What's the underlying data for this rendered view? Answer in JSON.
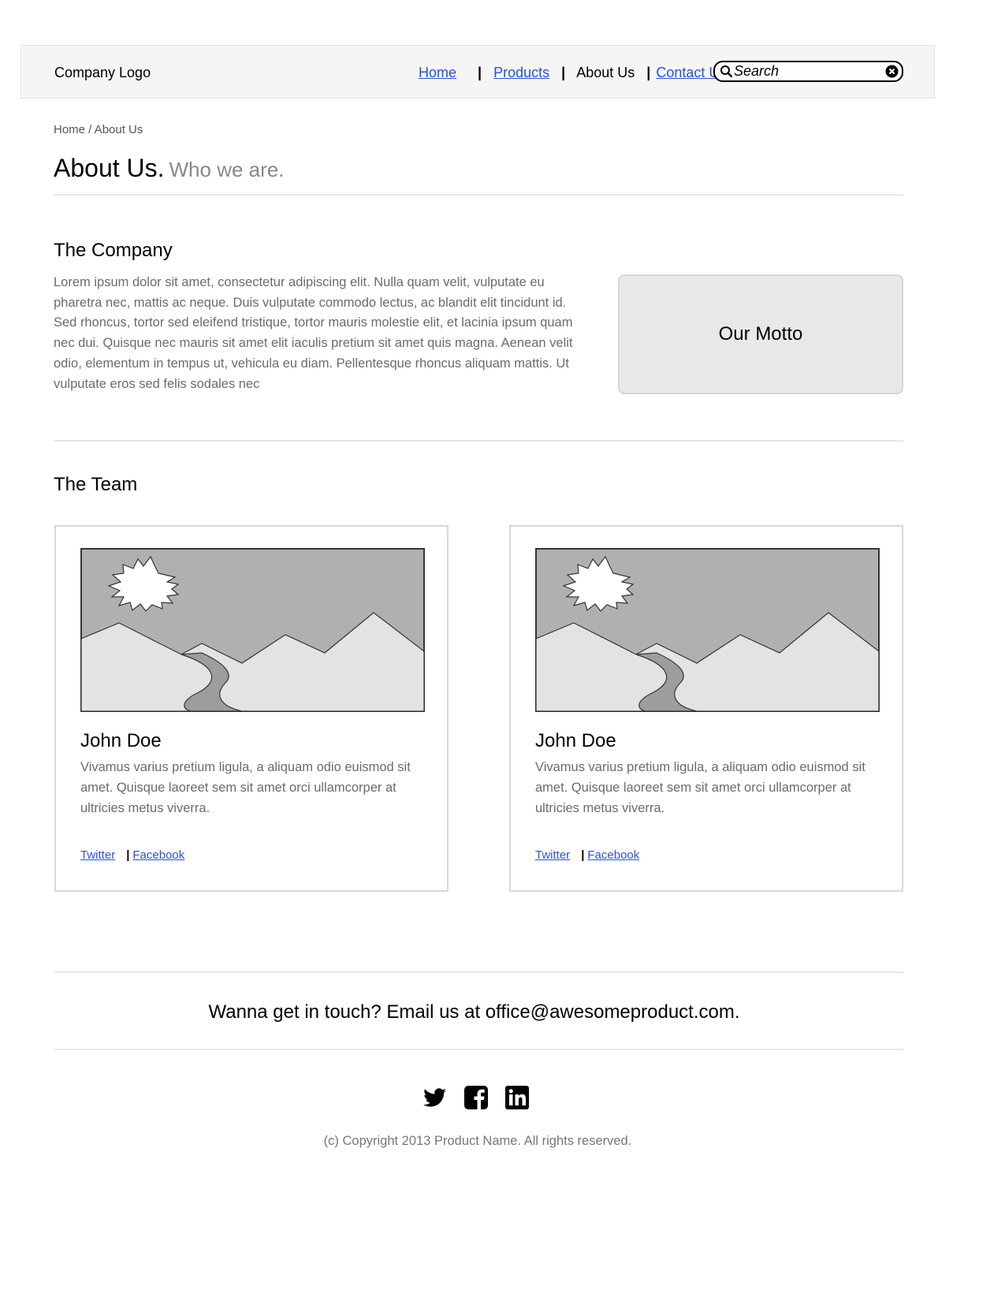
{
  "header": {
    "logo": "Company Logo",
    "nav": [
      {
        "label": "Home"
      },
      {
        "label": "Products"
      },
      {
        "label": "About Us"
      },
      {
        "label": "Contact Us"
      }
    ],
    "search": {
      "placeholder": "Search",
      "icon": "search-icon",
      "clear_icon": "clear-icon"
    }
  },
  "breadcrumb": "Home / About Us",
  "page": {
    "title": "About Us.",
    "subtitle": "Who we are."
  },
  "company": {
    "heading": "The Company",
    "text": "Lorem ipsum dolor sit amet, consectetur adipiscing elit. Nulla quam velit, vulputate eu pharetra nec, mattis ac neque. Duis vulputate commodo lectus, ac blandit elit tincidunt id. Sed rhoncus, tortor sed eleifend tristique, tortor mauris molestie elit, et lacinia ipsum quam nec dui. Quisque nec mauris sit amet elit iaculis pretium sit amet quis magna. Aenean velit odio, elementum in tempus ut, vehicula eu diam. Pellentesque rhoncus aliquam mattis. Ut vulputate eros sed felis sodales nec",
    "motto": "Our Motto"
  },
  "team": {
    "heading": "The Team",
    "members": [
      {
        "name": "John Doe",
        "bio": "Vivamus varius pretium ligula, a aliquam odio euismod sit amet. Quisque laoreet sem sit amet orci ullamcorper at ultricies metus viverra.",
        "links": [
          "Twitter",
          "Facebook"
        ]
      },
      {
        "name": "John Doe",
        "bio": "Vivamus varius pretium ligula, a aliquam odio euismod sit amet. Quisque laoreet sem sit amet orci ullamcorper at ultricies metus viverra.",
        "links": [
          "Twitter",
          "Facebook"
        ]
      }
    ]
  },
  "contact": "Wanna get in touch? Email us at office@awesomeproduct.com.",
  "social_icons": [
    "twitter-icon",
    "facebook-icon",
    "linkedin-icon"
  ],
  "copyright": "(c) Copyright 2013 Product Name. All rights reserved.",
  "colors": {
    "link": "#2a52d8",
    "header_bg": "#f5f5f5",
    "motto_bg": "#e8e8e8",
    "muted_text": "#6b6b6b"
  }
}
